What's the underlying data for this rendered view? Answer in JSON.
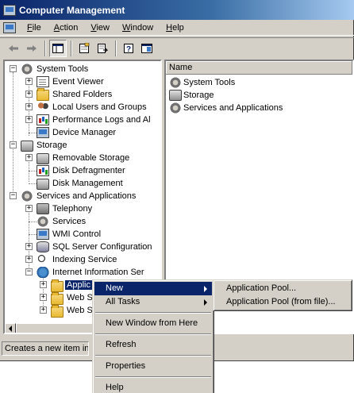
{
  "window": {
    "title": "Computer Management"
  },
  "menu": [
    {
      "label": "File",
      "accel": "F",
      "rest": "ile"
    },
    {
      "label": "Action",
      "accel": "A",
      "rest": "ction"
    },
    {
      "label": "View",
      "accel": "V",
      "rest": "iew"
    },
    {
      "label": "Window",
      "accel": "W",
      "rest": "indow"
    },
    {
      "label": "Help",
      "accel": "H",
      "rest": "elp"
    }
  ],
  "toolbar": {
    "buttons": [
      "back-arrow-icon",
      "forward-arrow-icon",
      "show-hide-tree-icon",
      "properties-icon",
      "export-list-icon",
      "help-icon",
      "console-icon"
    ]
  },
  "tree": {
    "system_tools": "System Tools",
    "event_viewer": "Event Viewer",
    "shared_folders": "Shared Folders",
    "local_users": "Local Users and Groups",
    "perf_logs": "Performance Logs and Al",
    "device_manager": "Device Manager",
    "storage": "Storage",
    "removable_storage": "Removable Storage",
    "disk_defrag": "Disk Defragmenter",
    "disk_mgmt": "Disk Management",
    "services_apps": "Services and Applications",
    "telephony": "Telephony",
    "services": "Services",
    "wmi": "WMI Control",
    "sql": "SQL Server Configuration",
    "indexing": "Indexing Service",
    "iis": "Internet Information Ser",
    "app_pools": "Applic",
    "web1": "Web S",
    "web2": "Web S"
  },
  "list": {
    "column_name": "Name",
    "items": [
      "System Tools",
      "Storage",
      "Services and Applications"
    ]
  },
  "status": {
    "text": "Creates a new item in t"
  },
  "context_menu": {
    "new": "New",
    "all_tasks": "All Tasks",
    "new_window": "New Window from Here",
    "refresh": "Refresh",
    "properties": "Properties",
    "help": "Help"
  },
  "submenu": {
    "app_pool": "Application Pool...",
    "app_pool_file": "Application Pool (from file)..."
  },
  "colors": {
    "selection": "#0a246a",
    "face": "#d4d0c8",
    "title_start": "#0a246a",
    "title_end": "#a6caf0"
  }
}
